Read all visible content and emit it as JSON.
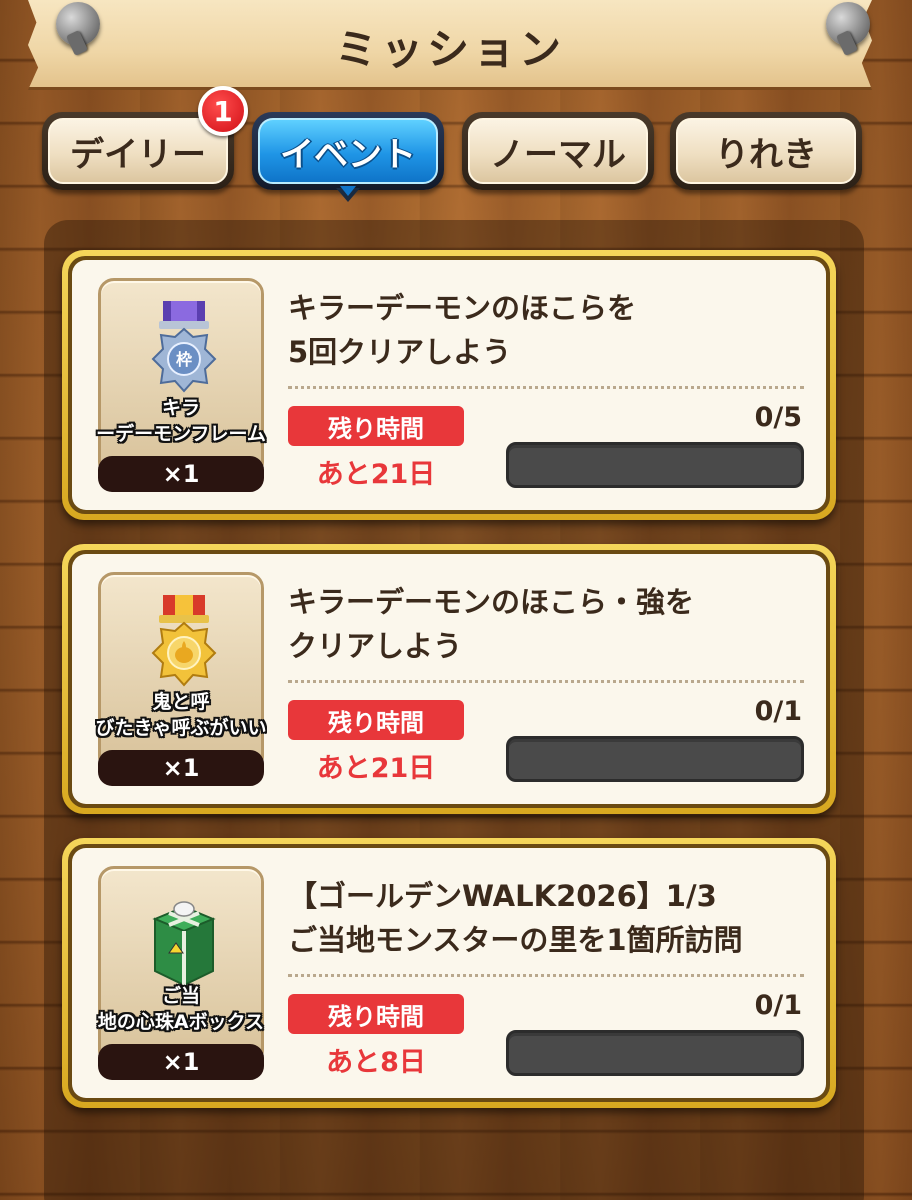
{
  "header": {
    "title": "ミッション"
  },
  "tabs": [
    {
      "label": "デイリー",
      "badge": "1",
      "active": false
    },
    {
      "label": "イベント",
      "active": true
    },
    {
      "label": "ノーマル",
      "active": false
    },
    {
      "label": "りれき",
      "active": false
    }
  ],
  "missions": [
    {
      "title_line1": "キラーデーモンのほこらを",
      "title_line2": "5回クリアしよう",
      "reward_name_line1": "キラ",
      "reward_name_line2": "ーデーモンフレーム",
      "reward_qty": "×1",
      "reward_icon": "silver-frame-medal-icon",
      "time_label": "残り時間",
      "time_remaining": "あと21日",
      "progress_text": "0/5",
      "progress": 0
    },
    {
      "title_line1": "キラーデーモンのほこら・強を",
      "title_line2": "クリアしよう",
      "reward_name_line1": "鬼と呼",
      "reward_name_line2": "びたきゃ呼ぶがいい",
      "reward_qty": "×1",
      "reward_icon": "gold-title-medal-icon",
      "time_label": "残り時間",
      "time_remaining": "あと21日",
      "progress_text": "0/1",
      "progress": 0
    },
    {
      "title_line1": "【ゴールデンWALK2026】1/3",
      "title_line2": "ご当地モンスターの里を1箇所訪問",
      "reward_name_line1": "ご当",
      "reward_name_line2": "地の心珠Aボックス",
      "reward_qty": "×1",
      "reward_icon": "gift-box-icon",
      "time_label": "残り時間",
      "time_remaining": "あと8日",
      "progress_text": "0/1",
      "progress": 0
    }
  ],
  "colors": {
    "accent_blue": "#1f95e6",
    "alert_red": "#e8373a",
    "card_gold": "#e6bd35",
    "text_dark": "#3b2a1c"
  }
}
